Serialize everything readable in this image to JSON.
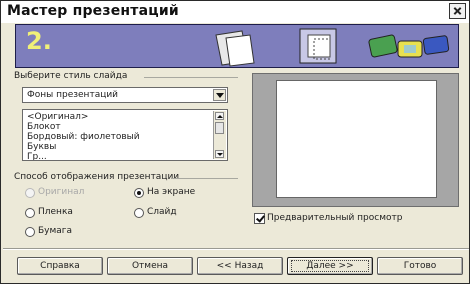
{
  "window": {
    "title": "Мастер презентаций"
  },
  "banner": {
    "step": "2."
  },
  "style_group": {
    "label": "Выберите стиль слайда",
    "combo_value": "Фоны презентаций",
    "list_items": [
      "<Оригинал>",
      "Блокот",
      "Бордовый: фиолетовый",
      "Буквы",
      "Гр..."
    ]
  },
  "display_group": {
    "label": "Способ отображения презентации",
    "options": [
      {
        "label": "Оригинал",
        "checked": false,
        "disabled": true
      },
      {
        "label": "На экране",
        "checked": true,
        "disabled": false
      },
      {
        "label": "Пленка",
        "checked": false,
        "disabled": false
      },
      {
        "label": "Слайд",
        "checked": false,
        "disabled": false
      },
      {
        "label": "Бумага",
        "checked": false,
        "disabled": false
      }
    ]
  },
  "preview_checkbox": {
    "label": "Предварительный просмотр",
    "checked": true
  },
  "buttons": {
    "help": "Справка",
    "cancel": "Отмена",
    "back": "<< Назад",
    "next": "Далее >>",
    "finish": "Готово"
  },
  "colors": {
    "banner": "#7e7ebc",
    "step_number": "#f0f078",
    "preview_bg": "#a6a6a6"
  }
}
